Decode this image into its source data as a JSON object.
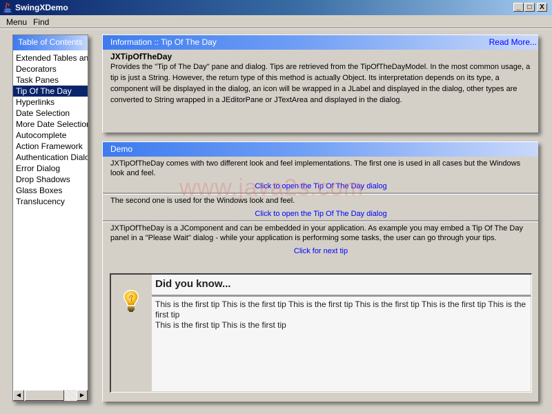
{
  "window": {
    "title": "SwingXDemo",
    "controls": {
      "minimize": "_",
      "maximize": "□",
      "close": "X"
    }
  },
  "menubar": {
    "items": [
      "Menu",
      "Find"
    ]
  },
  "toc": {
    "header": "Table of Contents",
    "items": [
      "Extended Tables and",
      "Decorators",
      "Task Panes",
      "Tip Of The Day",
      "Hyperlinks",
      "Date Selection",
      "More Date Selection",
      "Autocomplete",
      "Action Framework",
      "Authentication Dialogs",
      "Error Dialog",
      "Drop Shadows",
      "Glass Boxes",
      "Translucency"
    ],
    "selected": "Tip Of The Day"
  },
  "info": {
    "header": "Information :: Tip Of The Day",
    "read_more": "Read More...",
    "heading": "JXTipOfTheDay",
    "description": "Provides the \"Tip of The Day\" pane and dialog. Tips are retrieved from the TipOfTheDayModel. In the most common usage, a tip is just a String. However, the return type of this method is actually Object. Its interpretation depends on its type, a component will be displayed in the dialog, an icon will be wrapped in a JLabel and displayed in the dialog, other types are converted to String wrapped in a JEditorPane or JTextArea and displayed in the dialog."
  },
  "demo": {
    "header": "Demo",
    "sections": [
      {
        "text": "JXTipOfTheDay comes with two different look and feel implementations. The first one is used in all cases but the Windows look and feel.",
        "link": "Click to open the Tip Of The Day dialog"
      },
      {
        "text": "The second one is used for the Windows look and feel.",
        "link": "Click to open the Tip Of The Day dialog"
      },
      {
        "text": "JXTipOfTheDay is a JComponent and can be embedded in your application. As example you may embed a Tip Of The Day panel in a \"Please Wait\" dialog - while your application is performing some tasks, the user can go through your tips.",
        "link": "Click for next tip"
      }
    ],
    "tip": {
      "title": "Did you know...",
      "line1": "This is the first tip This is the first tip This is the first tip This is the first tip This is the first tip This is the first tip",
      "line2": "This is the first tip This is the first tip"
    }
  },
  "watermark": "www.java2s.com",
  "colors": {
    "selection": "#0a246a",
    "header_gradient_start": "#3d7bf0",
    "link": "#0000ff"
  }
}
